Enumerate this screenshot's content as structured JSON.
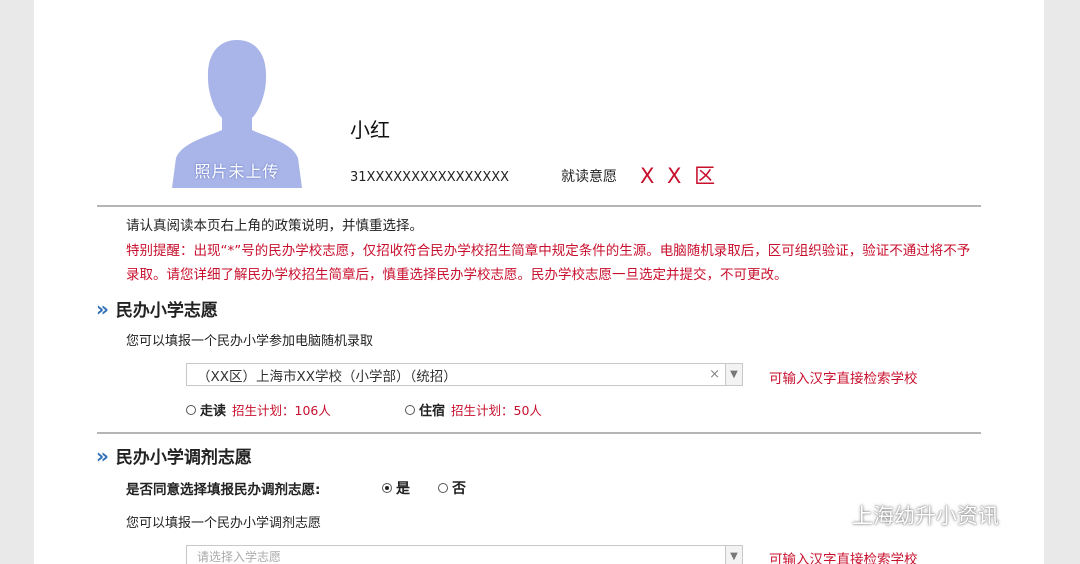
{
  "profile": {
    "photo_label": "照片未上传",
    "name": "小红",
    "id_number": "31XXXXXXXXXXXXXXXX",
    "intent_label": "就读意愿",
    "intent_value": "X X 区"
  },
  "notice": "请认真阅读本页右上角的政策说明，并慎重选择。",
  "warning": "特别提醒：出现“*”号的民办学校志愿，仅招收符合民办学校招生简章中规定条件的生源。电脑随机录取后，区可组织验证，验证不通过将不予录取。请您详细了解民办学校招生简章后，慎重选择民办学校志愿。民办学校志愿一旦选定并提交，不可更改。",
  "section1": {
    "title": "民办小学志愿",
    "hint": "您可以填报一个民办小学参加电脑随机录取",
    "selected_school": "（XX区）上海市XX学校（小学部）（统招）",
    "clear_symbol": "×",
    "search_hint": "可输入汉字直接检索学校",
    "options": [
      {
        "label": "走读",
        "plan": "招生计划：106人",
        "checked": false
      },
      {
        "label": "住宿",
        "plan": "招生计划：50人",
        "checked": false
      }
    ]
  },
  "section2": {
    "title": "民办小学调剂志愿",
    "question": "是否同意选择填报民办调剂志愿:",
    "yes_label": "是",
    "no_label": "否",
    "yes_checked": true,
    "hint": "您可以填报一个民办小学调剂志愿",
    "placeholder": "请选择入学志愿",
    "search_hint": "可输入汉字直接检索学校"
  },
  "watermark": "上海幼升小资讯",
  "icons": {
    "avatar": "person-silhouette-icon",
    "section_marker": "double-chevron-icon",
    "dropdown": "chevron-down-icon",
    "wechat": "wechat-icon"
  },
  "colors": {
    "accent_red": "#c8102e",
    "accent_blue": "#2f6fb6",
    "avatar_fill": "#a9b5e8"
  }
}
